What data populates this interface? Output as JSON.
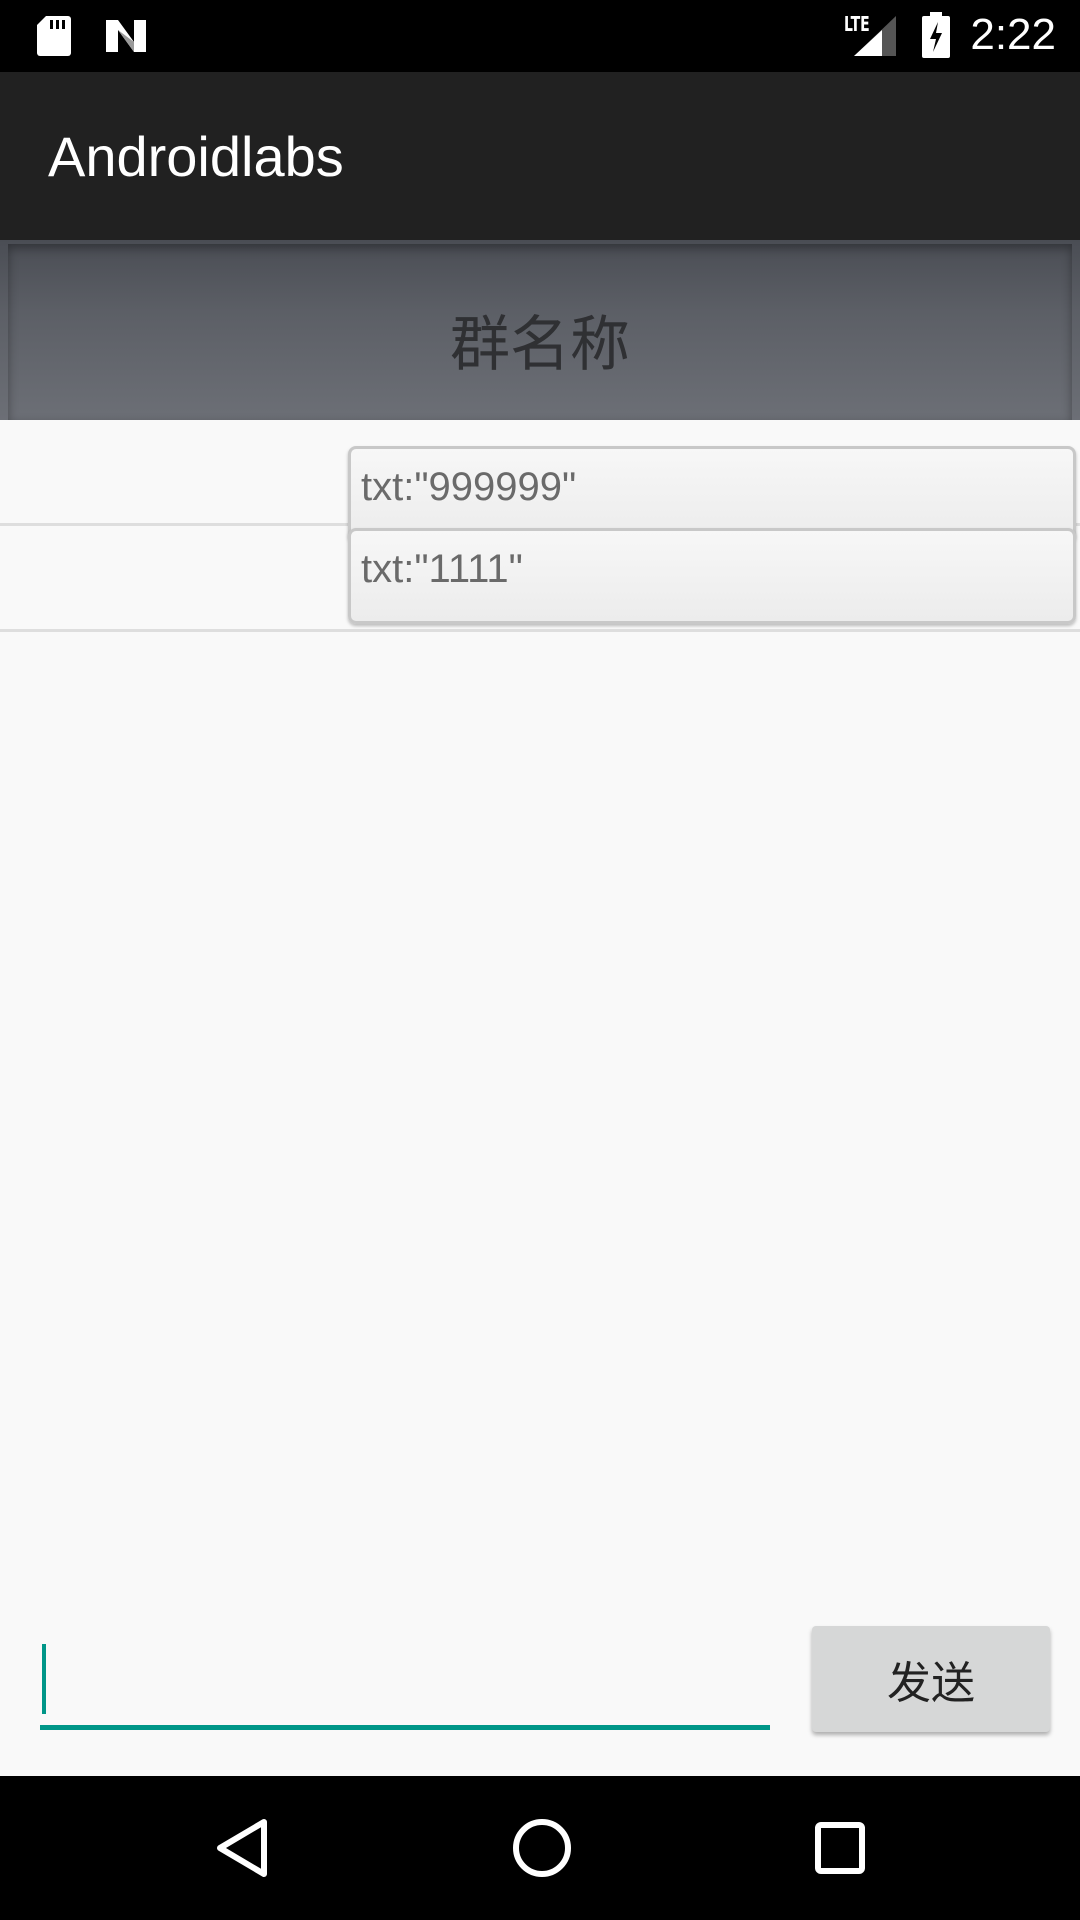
{
  "status_bar": {
    "network": "LTE",
    "time": "2:22",
    "icons": [
      "sd-card-icon",
      "n-notification-icon",
      "signal-icon",
      "battery-charging-icon"
    ]
  },
  "app_bar": {
    "title": "Androidlabs"
  },
  "group": {
    "name": "群名称"
  },
  "messages": [
    {
      "text": "txt:\"999999\""
    },
    {
      "text": "txt:\"1111\""
    }
  ],
  "composer": {
    "input_value": "",
    "placeholder": "",
    "send_label": "发送",
    "accent_color": "#009688"
  },
  "nav_bar": {
    "icons": [
      "back-icon",
      "home-icon",
      "recents-icon"
    ]
  }
}
